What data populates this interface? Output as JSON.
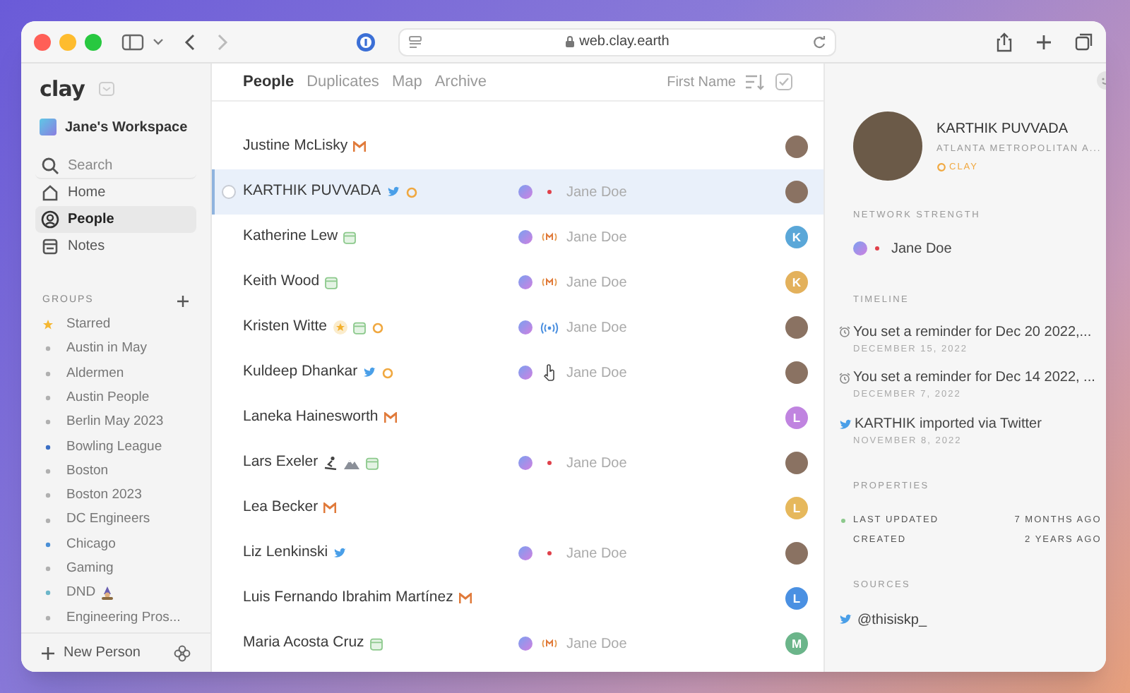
{
  "browser": {
    "url": "web.clay.earth"
  },
  "sidebar": {
    "logo": "clay",
    "workspace": "Jane's Workspace",
    "nav": [
      {
        "label": "Search",
        "kind": "search",
        "selected": false
      },
      {
        "label": "Home",
        "kind": "home",
        "selected": false
      },
      {
        "label": "People",
        "kind": "people",
        "selected": true
      },
      {
        "label": "Notes",
        "kind": "notes",
        "selected": false
      }
    ],
    "groups_heading": "GROUPS",
    "groups": [
      {
        "label": "Starred",
        "kind": "star",
        "color": "#f5b731"
      },
      {
        "label": "Austin in May",
        "kind": "dot",
        "color": "#b0b0b0"
      },
      {
        "label": "Aldermen",
        "kind": "dot",
        "color": "#b0b0b0"
      },
      {
        "label": "Austin People",
        "kind": "dot",
        "color": "#b0b0b0"
      },
      {
        "label": "Berlin May 2023",
        "kind": "dot",
        "color": "#b0b0b0"
      },
      {
        "label": "Bowling League",
        "kind": "dot",
        "color": "#3b6fc4"
      },
      {
        "label": "Boston",
        "kind": "dot",
        "color": "#b0b0b0"
      },
      {
        "label": "Boston 2023",
        "kind": "dot",
        "color": "#b0b0b0"
      },
      {
        "label": "DC Engineers",
        "kind": "dot",
        "color": "#b0b0b0"
      },
      {
        "label": "Chicago",
        "kind": "dot",
        "color": "#4a8fd6"
      },
      {
        "label": "Gaming",
        "kind": "dot",
        "color": "#b0b0b0"
      },
      {
        "label": "DND",
        "kind": "dot",
        "color": "#6cb6c9",
        "emoji": true
      },
      {
        "label": "Engineering Pros...",
        "kind": "dot",
        "color": "#b0b0b0"
      }
    ],
    "new_person": "New Person"
  },
  "tabs": [
    {
      "label": "People",
      "selected": true
    },
    {
      "label": "Duplicates",
      "selected": false
    },
    {
      "label": "Map",
      "selected": false
    },
    {
      "label": "Archive",
      "selected": false
    }
  ],
  "sort": {
    "label": "First Name"
  },
  "people": [
    {
      "name": "Justine McLisky",
      "tags": [
        {
          "kind": "gmail"
        }
      ],
      "avatar": {
        "kind": "photo"
      },
      "selected": false
    },
    {
      "name": "KARTHIK PUVVADA",
      "tags": [
        {
          "kind": "twitter"
        },
        {
          "kind": "clay"
        }
      ],
      "network": {
        "kind": "dot",
        "name": "Jane Doe"
      },
      "avatar": {
        "kind": "photo"
      },
      "selected": true
    },
    {
      "name": "Katherine Lew",
      "tags": [
        {
          "kind": "calendar"
        }
      ],
      "network": {
        "kind": "gmail",
        "name": "Jane Doe"
      },
      "avatar": {
        "kind": "initial",
        "letter": "K",
        "color": "#5aa7d8"
      },
      "selected": false
    },
    {
      "name": "Keith Wood",
      "tags": [
        {
          "kind": "calendar"
        }
      ],
      "network": {
        "kind": "gmail",
        "name": "Jane Doe"
      },
      "avatar": {
        "kind": "initial",
        "letter": "K",
        "color": "#e3b15c"
      },
      "selected": false
    },
    {
      "name": "Kristen Witte",
      "tags": [
        {
          "kind": "star"
        },
        {
          "kind": "calendar"
        },
        {
          "kind": "clay"
        }
      ],
      "network": {
        "kind": "waves",
        "name": "Jane Doe"
      },
      "avatar": {
        "kind": "photo"
      },
      "selected": false
    },
    {
      "name": "Kuldeep Dhankar",
      "tags": [
        {
          "kind": "twitter"
        },
        {
          "kind": "clay"
        }
      ],
      "network": {
        "kind": "cursor",
        "name": "Jane Doe"
      },
      "avatar": {
        "kind": "photo"
      },
      "selected": false
    },
    {
      "name": "Laneka Hainesworth",
      "tags": [
        {
          "kind": "gmail"
        }
      ],
      "avatar": {
        "kind": "initial",
        "letter": "L",
        "color": "#c084e0"
      },
      "selected": false
    },
    {
      "name": "Lars Exeler",
      "tags": [
        {
          "kind": "skier"
        },
        {
          "kind": "mountain"
        },
        {
          "kind": "calendar"
        }
      ],
      "network": {
        "kind": "dot",
        "name": "Jane Doe"
      },
      "avatar": {
        "kind": "photo"
      },
      "selected": false
    },
    {
      "name": "Lea Becker",
      "tags": [
        {
          "kind": "gmail"
        }
      ],
      "avatar": {
        "kind": "initial",
        "letter": "L",
        "color": "#e6b85c"
      },
      "selected": false
    },
    {
      "name": "Liz Lenkinski",
      "tags": [
        {
          "kind": "twitter"
        }
      ],
      "network": {
        "kind": "dot",
        "name": "Jane Doe"
      },
      "avatar": {
        "kind": "photo"
      },
      "selected": false
    },
    {
      "name": "Luis Fernando Ibrahim Martínez",
      "tags": [
        {
          "kind": "gmail"
        }
      ],
      "avatar": {
        "kind": "initial",
        "letter": "L",
        "color": "#4a90e2"
      },
      "selected": false
    },
    {
      "name": "Maria Acosta Cruz",
      "tags": [
        {
          "kind": "calendar"
        }
      ],
      "network": {
        "kind": "gmail",
        "name": "Jane Doe"
      },
      "avatar": {
        "kind": "initial",
        "letter": "M",
        "color": "#6bb58a"
      },
      "selected": false
    }
  ],
  "detail": {
    "name": "KARTHIK PUVVADA",
    "location": "ATLANTA METROPOLITAN A...",
    "source_badge": "CLAY",
    "network_heading": "NETWORK STRENGTH",
    "network": {
      "kind": "dot",
      "name": "Jane Doe"
    },
    "timeline_heading": "TIMELINE",
    "timeline": [
      {
        "kind": "alarm",
        "text": "You set a reminder for Dec 20 2022,...",
        "date": "DECEMBER 15, 2022"
      },
      {
        "kind": "alarm",
        "text": "You set a reminder for Dec 14 2022, ...",
        "date": "DECEMBER 7, 2022"
      },
      {
        "kind": "twitter",
        "text": "KARTHIK imported via Twitter",
        "date": "NOVEMBER 8, 2022"
      }
    ],
    "properties_heading": "PROPERTIES",
    "properties": [
      {
        "label": "LAST UPDATED",
        "value": "7 MONTHS AGO",
        "marker": true
      },
      {
        "label": "CREATED",
        "value": "2 YEARS AGO",
        "marker": false
      }
    ],
    "sources_heading": "SOURCES",
    "sources": [
      {
        "kind": "twitter",
        "handle": "@thisiskp_"
      }
    ]
  }
}
